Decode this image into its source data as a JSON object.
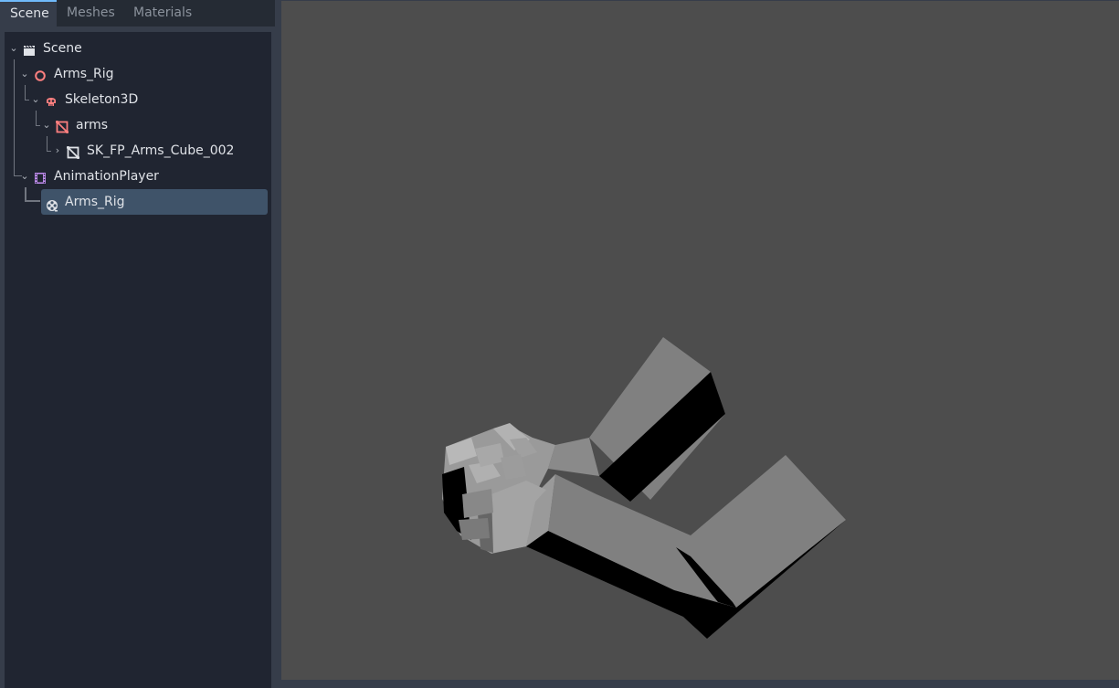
{
  "tabs": [
    {
      "label": "Scene",
      "active": true
    },
    {
      "label": "Meshes",
      "active": false
    },
    {
      "label": "Materials",
      "active": false
    }
  ],
  "tree": [
    {
      "label": "Scene",
      "icon": "scene-clapper-icon",
      "expanded": true
    },
    {
      "label": "Arms_Rig",
      "icon": "node3d-circle-icon",
      "expanded": true
    },
    {
      "label": "Skeleton3D",
      "icon": "skeleton-skull-icon",
      "expanded": true
    },
    {
      "label": "arms",
      "icon": "mesh-instance-icon",
      "expanded": true
    },
    {
      "label": "SK_FP_Arms_Cube_002",
      "icon": "mesh-resource-icon",
      "expanded": false
    },
    {
      "label": "AnimationPlayer",
      "icon": "animation-player-film-icon",
      "expanded": true
    },
    {
      "label": "Arms_Rig",
      "icon": "animation-reel-icon",
      "selected": true
    }
  ],
  "colors": {
    "panel": "#363d4a",
    "tree_background": "#202531",
    "selection": "#3f5369",
    "viewport": "#4d4d4d",
    "accent": "#70bafa",
    "node_red": "#fc7f7f",
    "anim_purple": "#c38ef1"
  }
}
